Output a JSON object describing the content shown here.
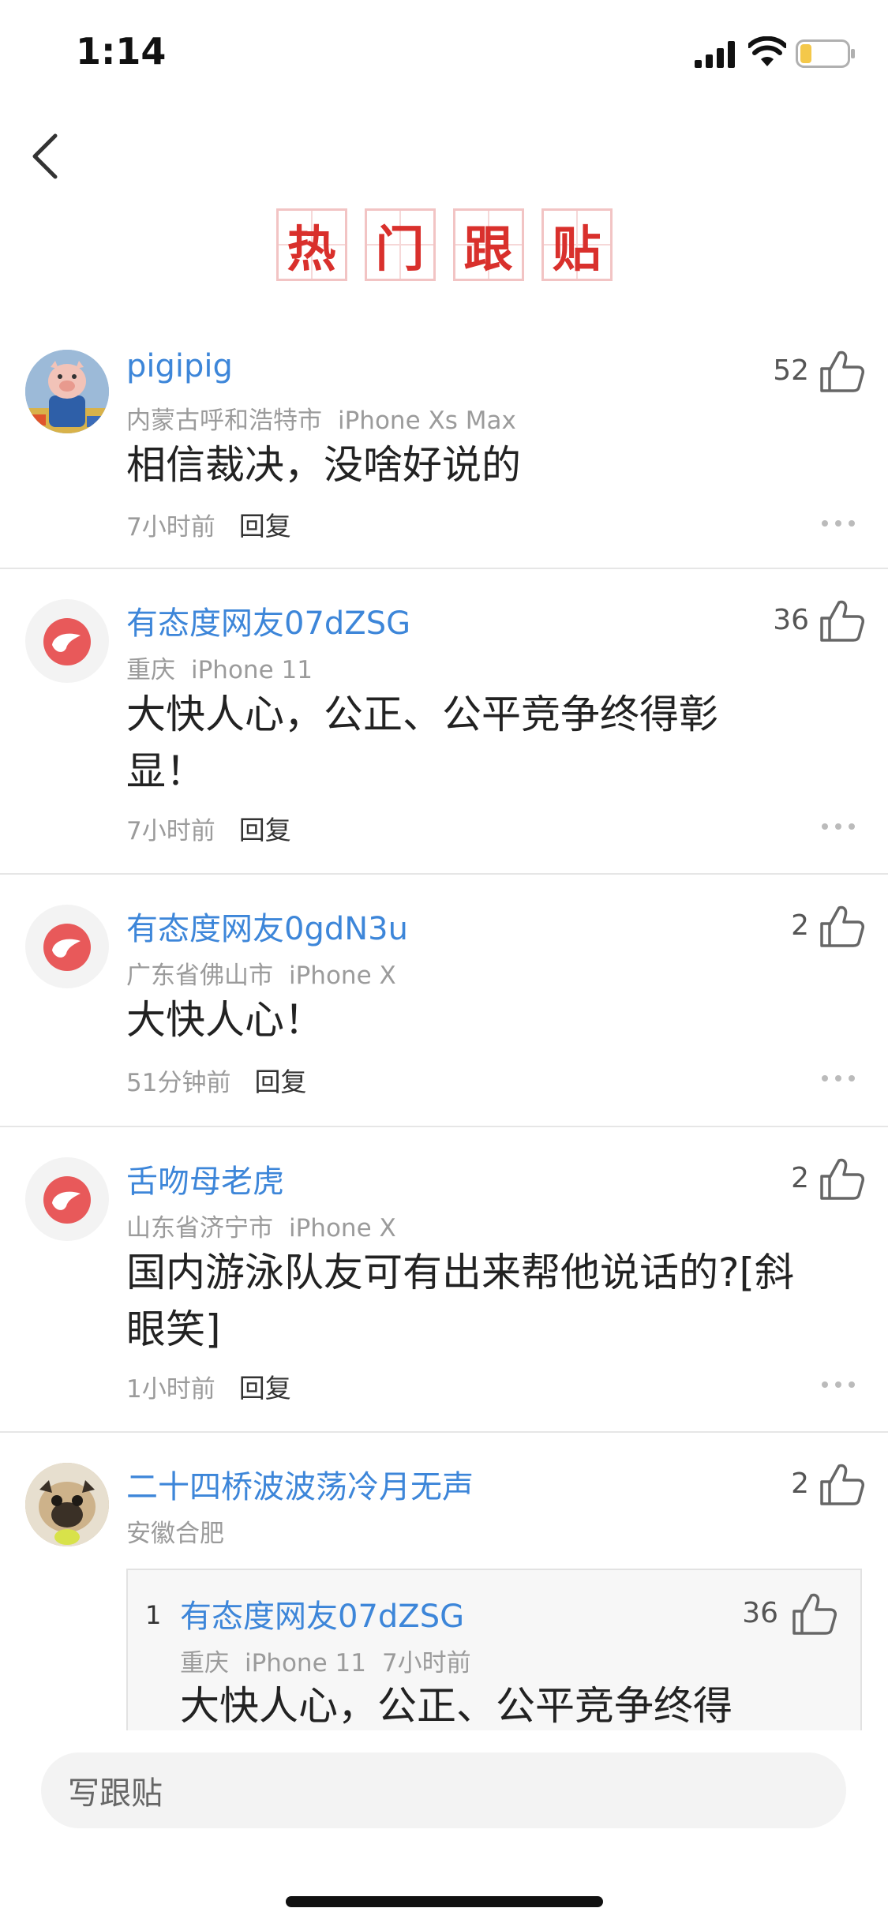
{
  "status_bar": {
    "time": "1:14"
  },
  "header": {
    "title_chars": [
      "热",
      "门",
      "跟",
      "贴"
    ]
  },
  "comments": [
    {
      "username": "pigipig",
      "location": "内蒙古呼和浩特市",
      "device": "iPhone Xs Max",
      "content": "相信裁决，没啥好说的",
      "time": "7小时前",
      "reply_label": "回复",
      "likes": "52"
    },
    {
      "username": "有态度网友07dZSG",
      "location": "重庆",
      "device": "iPhone 11",
      "content": "大快人心，公正、公平竞争终得彰显！",
      "time": "7小时前",
      "reply_label": "回复",
      "likes": "36"
    },
    {
      "username": "有态度网友0gdN3u",
      "location": "广东省佛山市",
      "device": "iPhone X",
      "content": "大快人心！",
      "time": "51分钟前",
      "reply_label": "回复",
      "likes": "2"
    },
    {
      "username": "舌吻母老虎",
      "location": "山东省济宁市",
      "device": "iPhone X",
      "content": "国内游泳队友可有出来帮他说话的?[斜眼笑]",
      "time": "1小时前",
      "reply_label": "回复",
      "likes": "2"
    },
    {
      "username": "二十四桥波波荡冷月无声",
      "location": "安徽合肥",
      "likes": "2",
      "quoted": {
        "index": "1",
        "username": "有态度网友07dZSG",
        "location": "重庆",
        "device": "iPhone 11",
        "time": "7小时前",
        "content": "大快人心，公正、公平竞争终得",
        "likes": "36"
      }
    }
  ],
  "bottom_bar": {
    "input_placeholder": "写跟贴"
  },
  "colors": {
    "accent_blue": "#3d86d9",
    "title_red": "#d9302c",
    "meta_gray": "#9b9b9b",
    "divider": "#e6e6e6"
  },
  "icons": {
    "back": "chevron-left-icon",
    "like": "thumbs-up-icon",
    "more": "more-dots-icon",
    "avatar_default": "netease-logo-icon"
  }
}
